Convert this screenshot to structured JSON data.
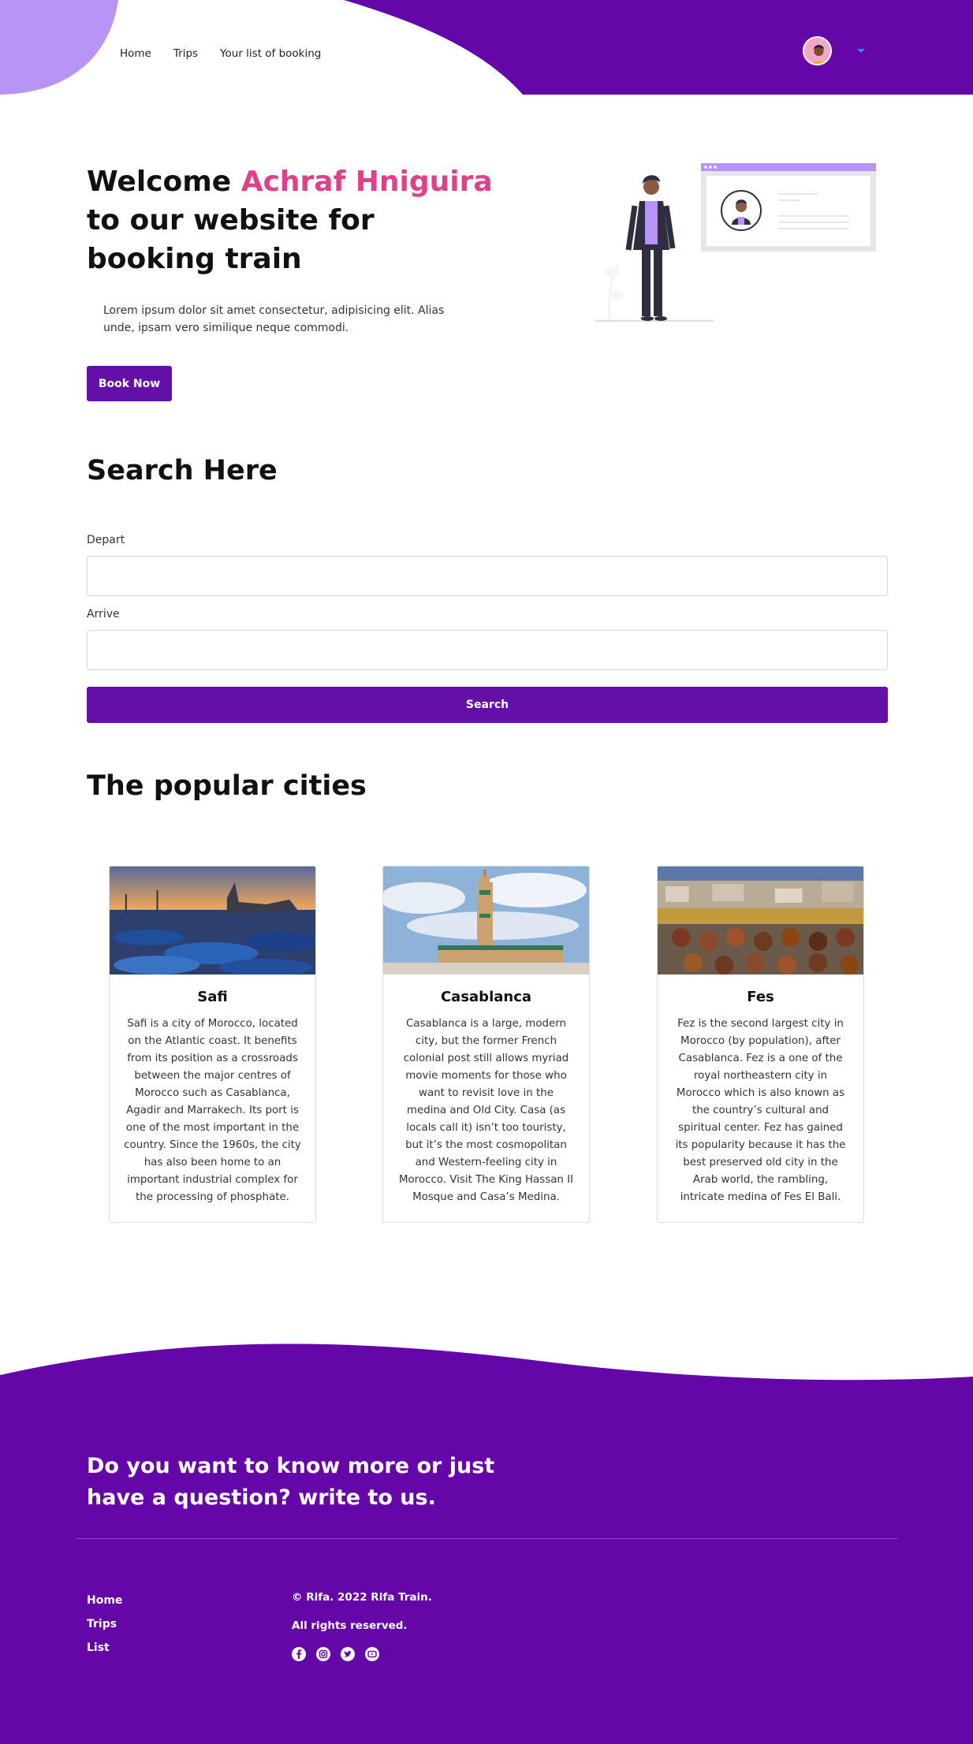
{
  "nav": {
    "items": [
      {
        "label": "Home"
      },
      {
        "label": "Trips"
      },
      {
        "label": "Your list of booking"
      }
    ]
  },
  "hero": {
    "title_before": "Welcome ",
    "user_name": "Achraf Hniguira",
    "title_after": " to our website for booking train",
    "text": "Lorem ipsum dolor sit amet consectetur, adipisicing elit. Alias unde, ipsam vero similique neque commodi.",
    "button": "Book Now"
  },
  "search": {
    "title": "Search Here",
    "depart_label": "Depart",
    "depart_value": "",
    "arrive_label": "Arrive",
    "arrive_value": "",
    "button": "Search"
  },
  "cities": {
    "title": "The popular cities",
    "items": [
      {
        "name": "Safi",
        "text": "Safi is a city of Morocco, located on the Atlantic coast. It benefits from its position as a crossroads between the major centres of Morocco such as Casablanca, Agadir and Marrakech. Its port is one of the most important in the country. Since the 1960s, the city has also been home to an important industrial complex for the processing of phosphate."
      },
      {
        "name": "Casablanca",
        "text": "Casablanca is a large, modern city, but the former French colonial post still allows myriad movie moments for those who want to revisit love in the medina and Old City. Casa (as locals call it) isn’t too touristy, but it’s the most cosmopolitan and Western-feeling city in Morocco. Visit The King Hassan II Mosque and Casa’s Medina."
      },
      {
        "name": "Fes",
        "text": "Fez is the second largest city in Morocco (by population), after Casablanca. Fez is a one of the royal northeastern city in Morocco which is also known as the country’s cultural and spiritual center. Fez has gained its popularity because it has the best preserved old city in the Arab world, the rambling, intricate medina of Fes El Bali."
      }
    ]
  },
  "footer": {
    "title": "Do you want to know more or just have a question? write to us.",
    "links": [
      {
        "label": "Home"
      },
      {
        "label": "Trips"
      },
      {
        "label": "List"
      }
    ],
    "copyright": "© Rifa. 2022 Rifa Train.",
    "rights": "All rights reserved.",
    "socials": [
      "facebook-icon",
      "instagram-icon",
      "twitter-icon",
      "youtube-icon"
    ]
  },
  "colors": {
    "primary": "#6410a8",
    "accent_pink": "#e0408a",
    "light_purple": "#b794f6"
  }
}
